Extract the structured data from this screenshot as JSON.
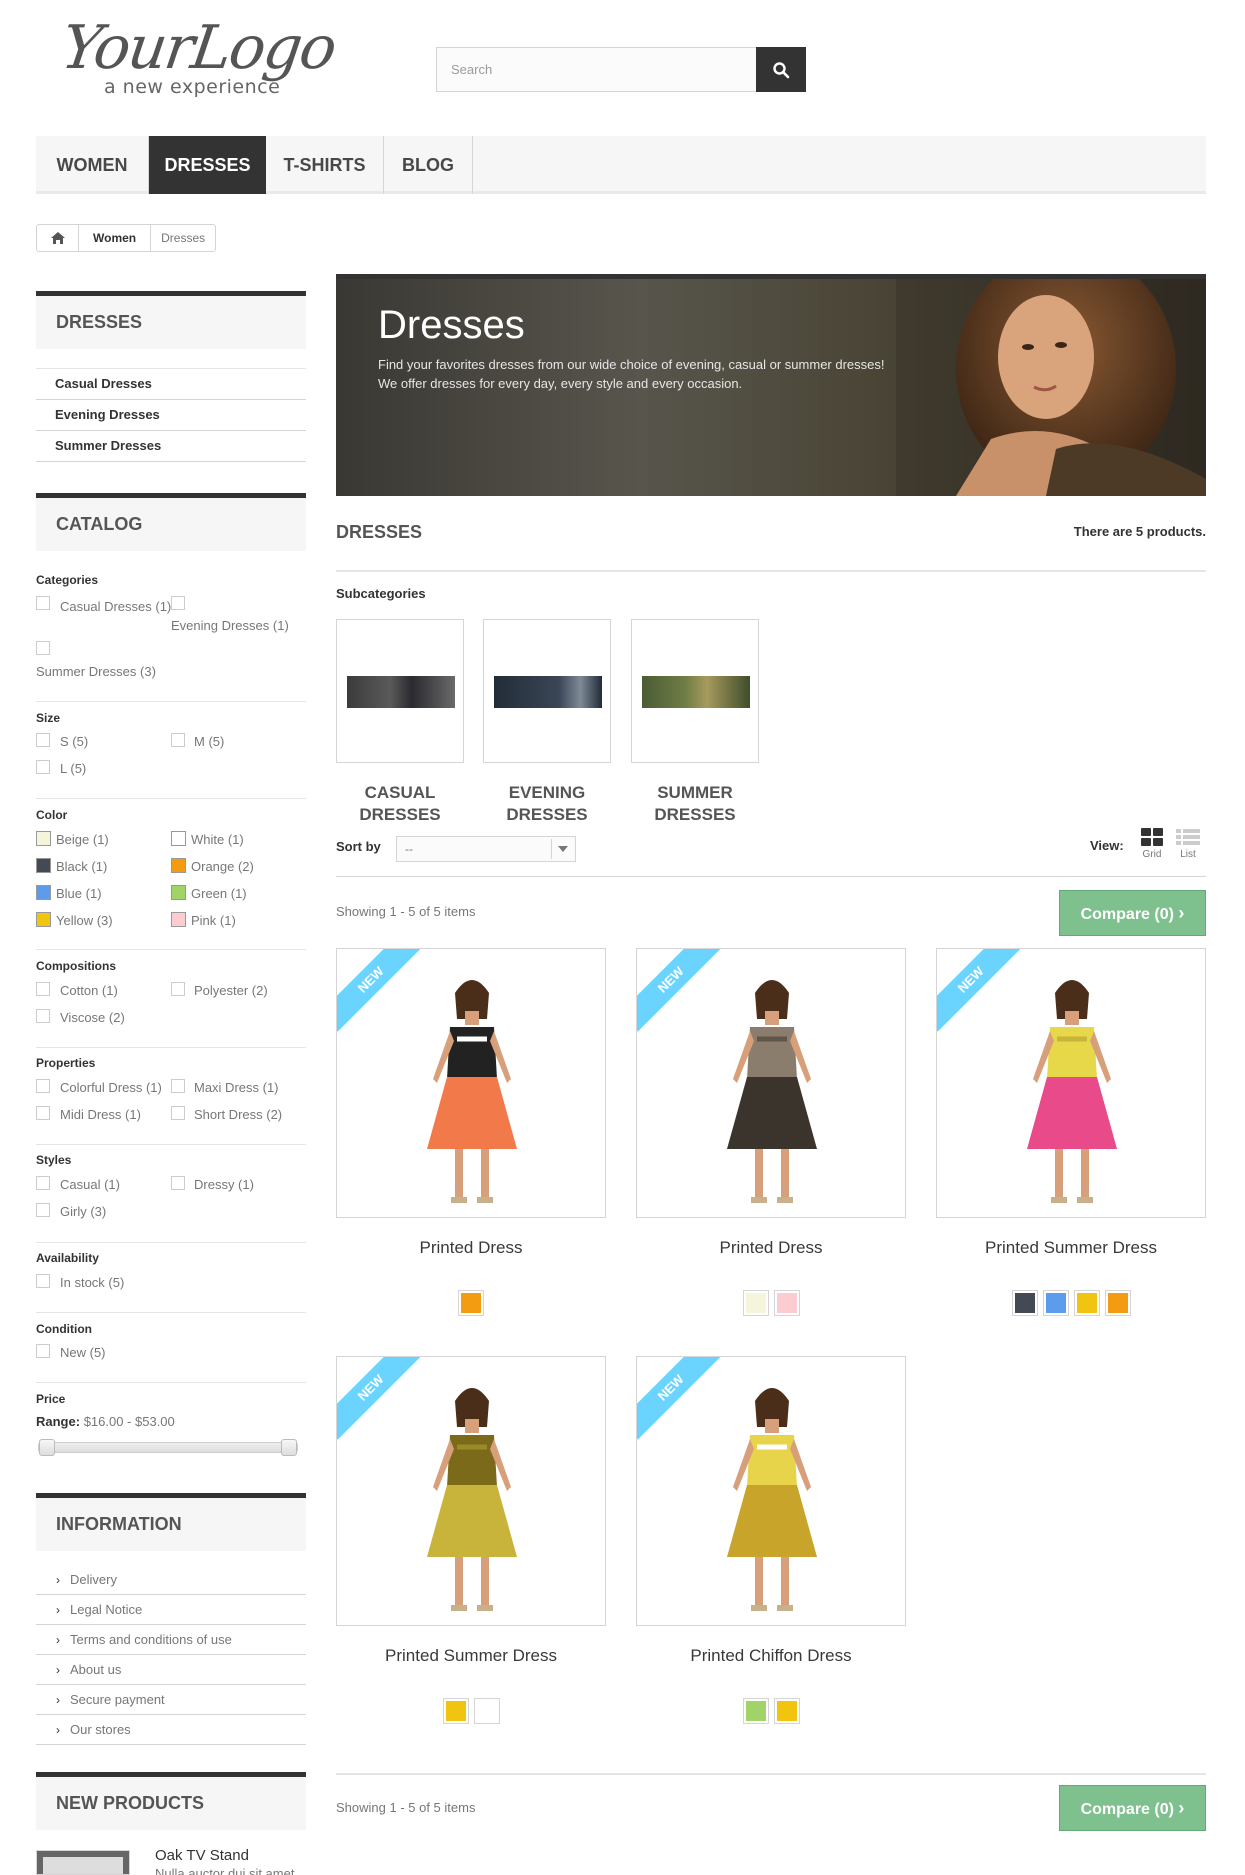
{
  "header": {
    "logo_text": "YourLogo",
    "logo_tagline": "a new experience",
    "search_placeholder": "Search"
  },
  "menu": [
    "WOMEN",
    "DRESSES",
    "T-SHIRTS",
    "BLOG"
  ],
  "breadcrumb": [
    "Women",
    "Dresses"
  ],
  "sidebar": {
    "dresses_title": "DRESSES",
    "dresses_links": [
      "Casual Dresses",
      "Evening Dresses",
      "Summer Dresses"
    ],
    "catalog_title": "CATALOG",
    "categories_label": "Categories",
    "categories": [
      "Casual Dresses (1)",
      "Evening Dresses (1)",
      "Summer Dresses (3)"
    ],
    "size_label": "Size",
    "sizes": [
      "S (5)",
      "M (5)",
      "L (5)"
    ],
    "color_label": "Color",
    "colors": [
      {
        "label": "Beige (1)",
        "hex": "#f5f5dc"
      },
      {
        "label": "White (1)",
        "hex": "#ffffff"
      },
      {
        "label": "Black (1)",
        "hex": "#434a54"
      },
      {
        "label": "Orange (2)",
        "hex": "#f39c11"
      },
      {
        "label": "Blue (1)",
        "hex": "#5d9cec"
      },
      {
        "label": "Green (1)",
        "hex": "#a0d468"
      },
      {
        "label": "Yellow (3)",
        "hex": "#f1c40f"
      },
      {
        "label": "Pink (1)",
        "hex": "#fcccd0"
      }
    ],
    "compositions_label": "Compositions",
    "compositions": [
      "Cotton (1)",
      "Polyester (2)",
      "Viscose (2)"
    ],
    "properties_label": "Properties",
    "properties": [
      "Colorful Dress (1)",
      "Maxi Dress (1)",
      "Midi Dress (1)",
      "Short Dress (2)"
    ],
    "styles_label": "Styles",
    "styles": [
      "Casual (1)",
      "Dressy (1)",
      "Girly (3)"
    ],
    "availability_label": "Availability",
    "availability": [
      "In stock (5)"
    ],
    "condition_label": "Condition",
    "condition": [
      "New (5)"
    ],
    "price_label": "Price",
    "range_label": "Range:",
    "range_value": "$16.00 - $53.00",
    "information_title": "INFORMATION",
    "information_links": [
      "Delivery",
      "Legal Notice",
      "Terms and conditions of use",
      "About us",
      "Secure payment",
      "Our stores"
    ],
    "new_products_title": "NEW PRODUCTS",
    "new_product_name": "Oak TV Stand",
    "new_product_desc": "Nulla auctor dui sit amet"
  },
  "main": {
    "banner_title": "Dresses",
    "banner_line1": "Find your favorites dresses from our wide choice of evening, casual or summer dresses!",
    "banner_line2": "We offer dresses for every day, every style and every occasion.",
    "heading": "DRESSES",
    "product_count": "There are 5 products.",
    "subcategories_label": "Subcategories",
    "subcategories": [
      {
        "line1": "CASUAL",
        "line2": "DRESSES"
      },
      {
        "line1": "EVENING",
        "line2": "DRESSES"
      },
      {
        "line1": "SUMMER",
        "line2": "DRESSES"
      }
    ],
    "sort_label": "Sort by",
    "sort_value": "--",
    "view_label": "View:",
    "grid_label": "Grid",
    "list_label": "List",
    "showing": "Showing 1 - 5 of 5 items",
    "compare_label": "Compare (0)",
    "new_label": "New",
    "products": [
      {
        "name": "Printed Dress",
        "colors": [
          "#f39c11"
        ]
      },
      {
        "name": "Printed Dress",
        "colors": [
          "#f5f5dc",
          "#fcccd0"
        ]
      },
      {
        "name": "Printed Summer Dress",
        "colors": [
          "#434a54",
          "#5d9cec",
          "#f1c40f",
          "#f39c11"
        ]
      },
      {
        "name": "Printed Summer Dress",
        "colors": [
          "#f1c40f",
          "#ffffff"
        ]
      },
      {
        "name": "Printed Chiffon Dress",
        "colors": [
          "#a0d468",
          "#f1c40f"
        ]
      }
    ]
  }
}
